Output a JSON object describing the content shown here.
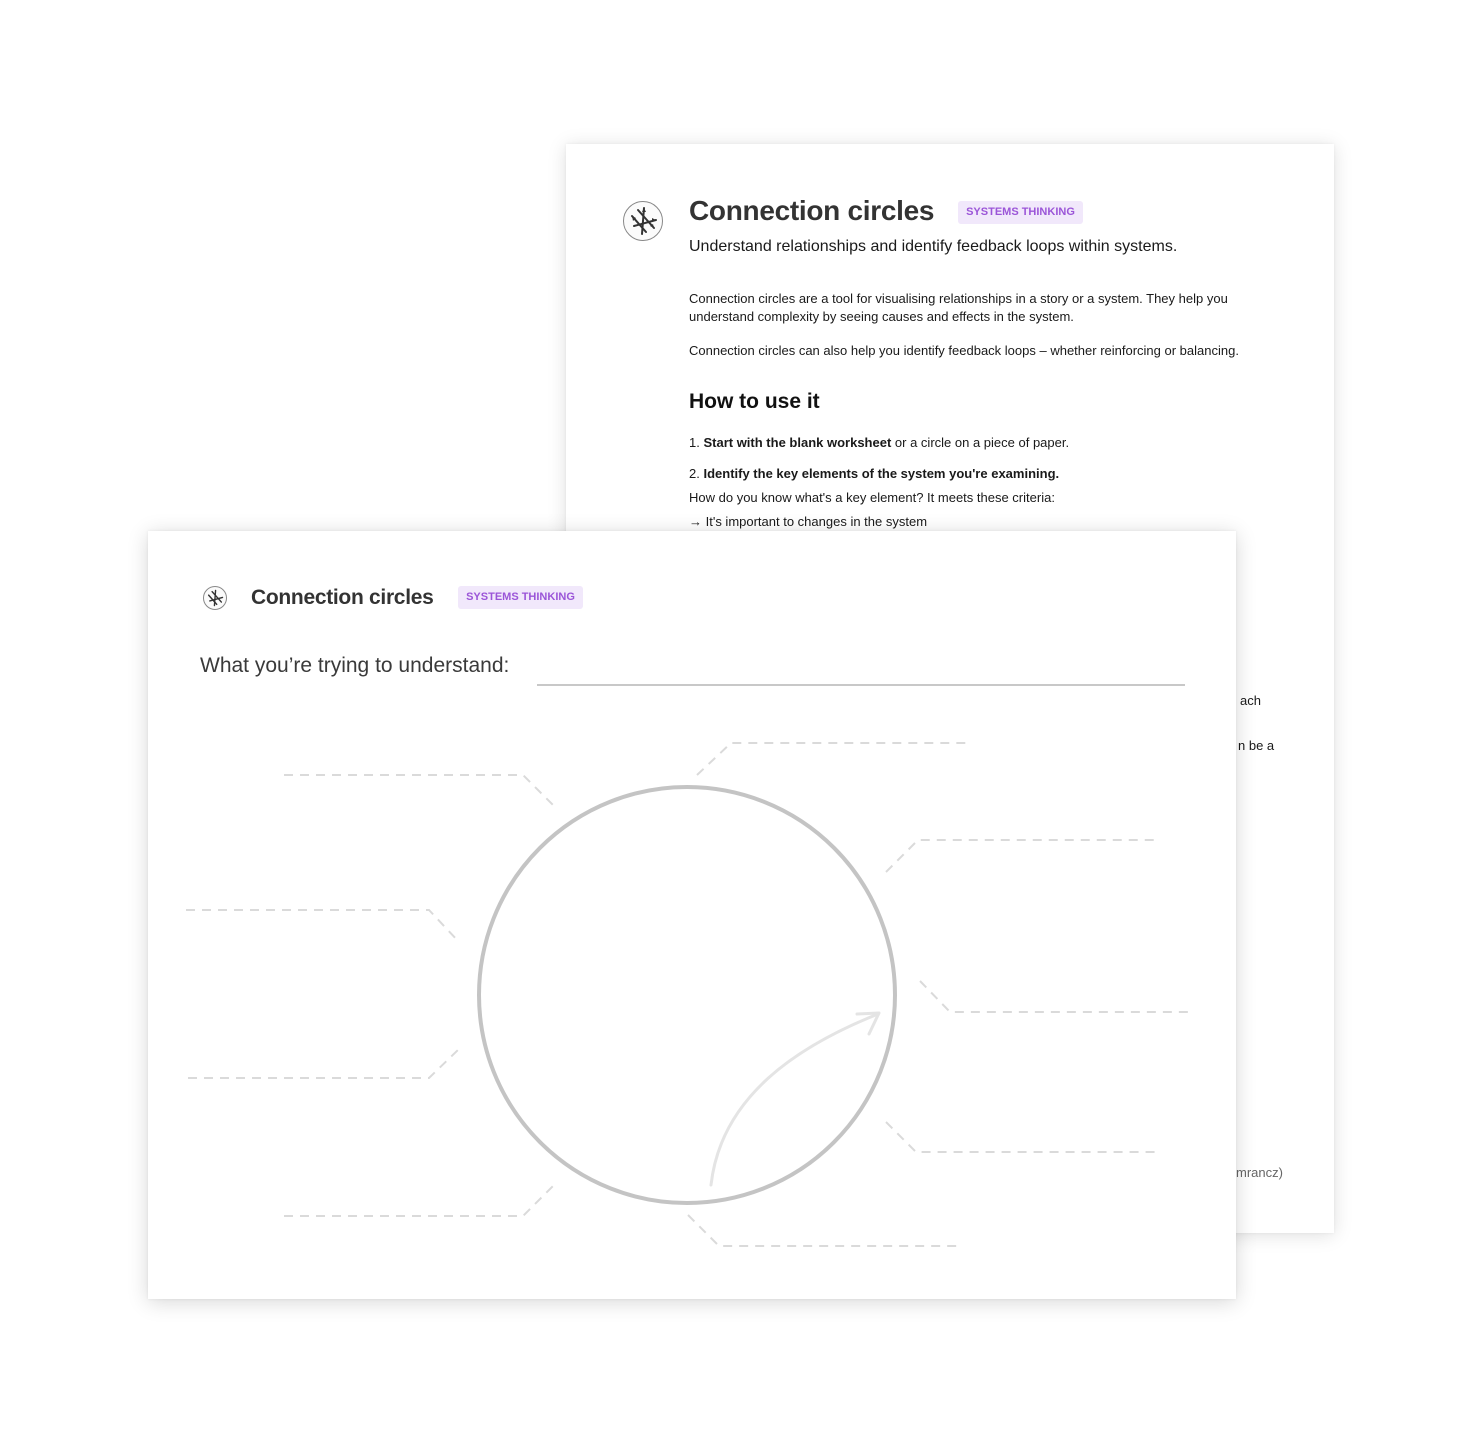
{
  "back_sheet": {
    "title": "Connection circles",
    "badge": "SYSTEMS THINKING",
    "subtitle": "Understand relationships and identify feedback loops within systems.",
    "intro_line1": "Connection circles are a tool for visualising relationships in a story or a system. They help you",
    "intro_line2": "understand complexity by seeing causes and effects in the system.",
    "intro_para2": "Connection circles can also help you identify feedback loops – whether reinforcing or balancing.",
    "section_heading": "How to use it",
    "step1_number": "1.",
    "step1_bold": "Start with the blank worksheet",
    "step1_rest": "or a circle on a piece of paper.",
    "step2_number": "2.",
    "step2_bold": "Identify the key elements of the system you're examining.",
    "step2_question": "How do you know what's a key element? It meets these criteria:",
    "criterion1": "→ It's important to changes in the system",
    "peek1": "ach",
    "peek2": "n be a",
    "peek3": "mrancz)"
  },
  "front_sheet": {
    "title": "Connection circles",
    "badge": "SYSTEMS THINKING",
    "prompt_label": "What you’re trying to understand:"
  },
  "colors": {
    "badge_bg": "#f1e8fb",
    "badge_text": "#9b55d8",
    "circle_stroke": "#c4c4c4",
    "dashed_line": "#dadada",
    "arrow": "#e4e4e4"
  },
  "icons": [
    "connection-circle-logo-icon"
  ]
}
